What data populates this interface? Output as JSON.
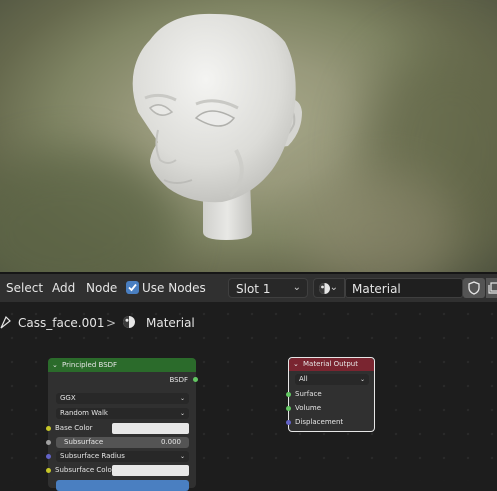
{
  "header": {
    "menu": [
      "Select",
      "Add",
      "Node"
    ],
    "use_nodes_label": "Use Nodes",
    "use_nodes_checked": true,
    "slot": "Slot 1",
    "material_name": "Material"
  },
  "breadcrumb": {
    "object": "Cass_face.001",
    "separator": ">",
    "material": "Material"
  },
  "nodes": {
    "bsdf": {
      "title": "Principled BSDF",
      "output": "BSDF",
      "distribution": "GGX",
      "subsurface_method": "Random Walk",
      "base_color_label": "Base Color",
      "subsurface_label": "Subsurface",
      "subsurface_value": "0.000",
      "subsurface_radius_label": "Subsurface Radius",
      "subsurface_color_label": "Subsurface Color"
    },
    "output": {
      "title": "Material Output",
      "target": "All",
      "inputs": [
        "Surface",
        "Volume",
        "Displacement"
      ]
    }
  },
  "colors": {
    "bsdf_header": "#2b6b2b",
    "output_header": "#7a2530",
    "socket_shader": "#63c763",
    "socket_color": "#c7c729",
    "socket_float": "#a1a1a1",
    "socket_vector": "#6363c7",
    "checkbox": "#4a7fc1"
  }
}
